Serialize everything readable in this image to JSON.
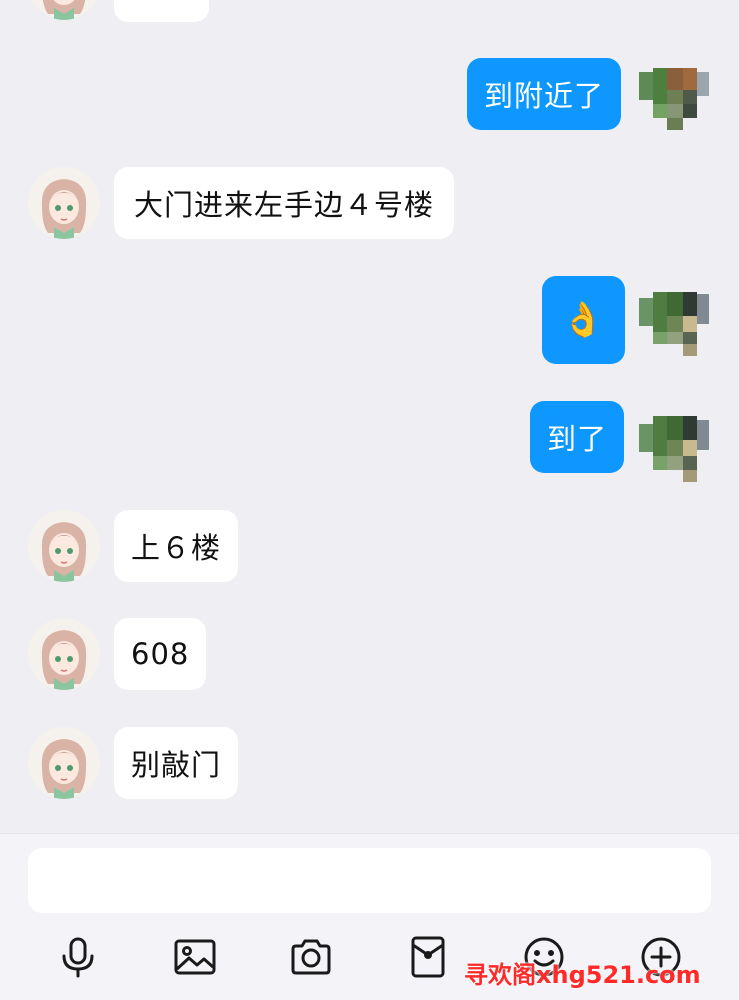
{
  "messages": [
    {
      "side": "in",
      "text": ""
    },
    {
      "side": "out",
      "text": "到附近了"
    },
    {
      "side": "in",
      "text": "大门进来左手边４号楼"
    },
    {
      "side": "out",
      "text": "👌"
    },
    {
      "side": "out",
      "text": "到了"
    },
    {
      "side": "in",
      "text": "上６楼"
    },
    {
      "side": "in",
      "text": "608"
    },
    {
      "side": "in",
      "text": "别敲门"
    }
  ],
  "input": {
    "value": ""
  },
  "toolbar": {
    "icons": [
      "microphone-icon",
      "image-icon",
      "camera-icon",
      "red-packet-icon",
      "emoji-icon",
      "plus-icon"
    ]
  },
  "watermark": "寻欢阁xhg521.com",
  "colors": {
    "background": "#eeeef3",
    "outgoing_bubble": "#0e98ff",
    "incoming_bubble": "#ffffff",
    "watermark": "#ff2a2a"
  }
}
